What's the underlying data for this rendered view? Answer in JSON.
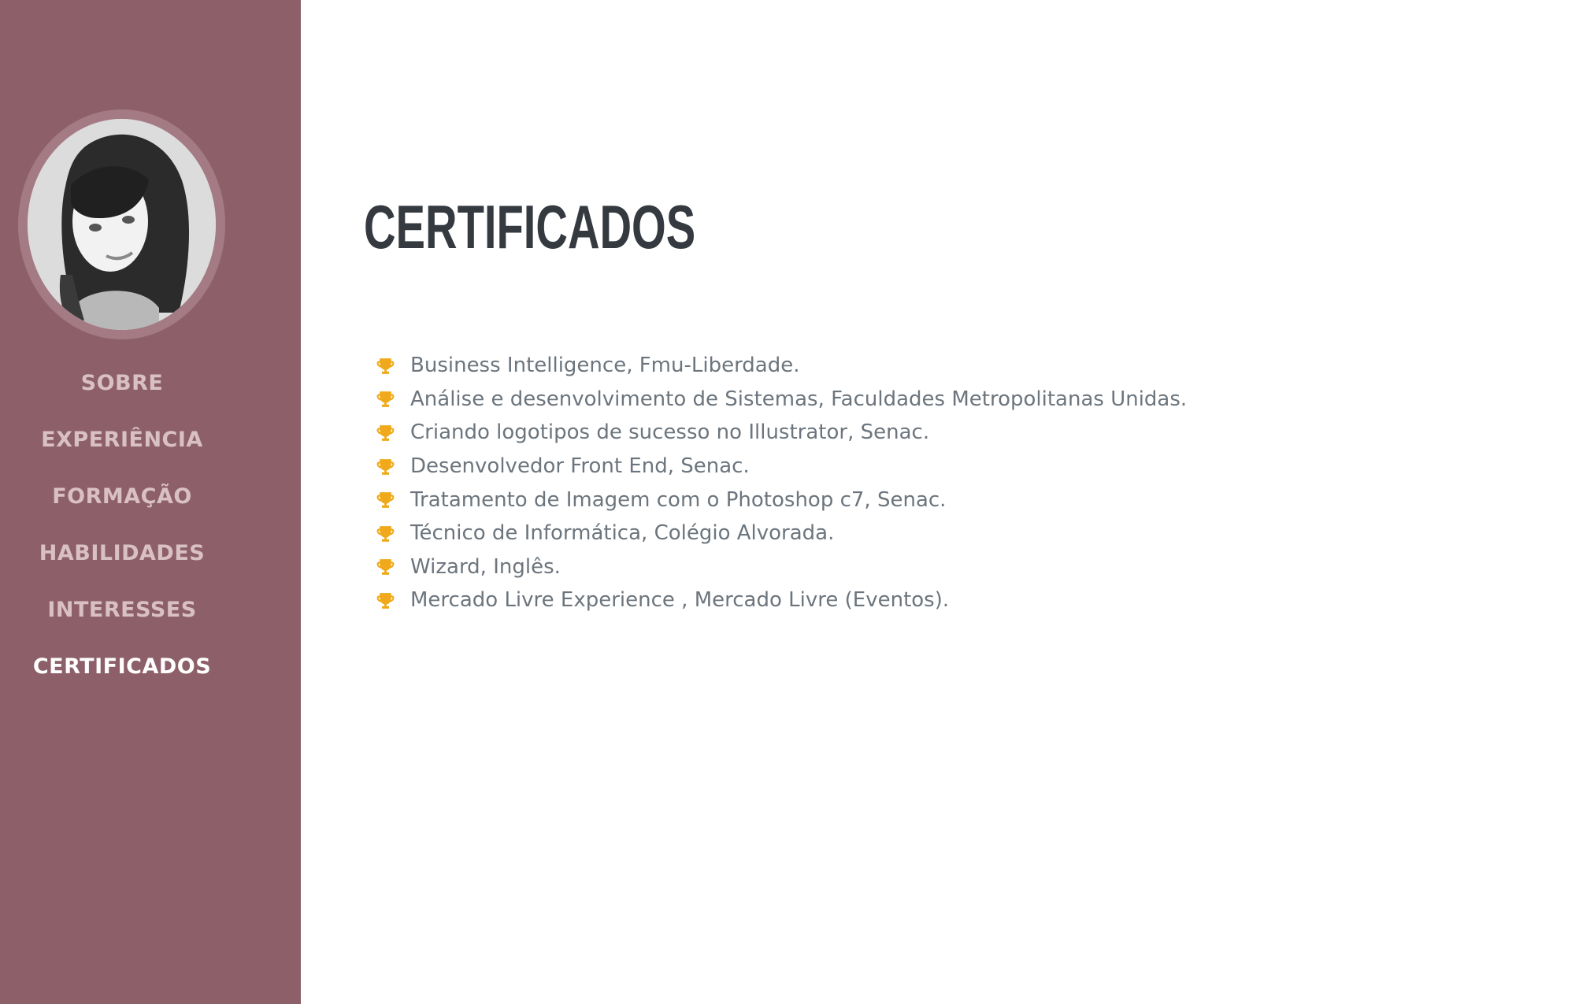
{
  "sidebar": {
    "avatar_icon": "profile-photo",
    "nav": [
      {
        "label": "SOBRE",
        "active": false
      },
      {
        "label": "EXPERIÊNCIA",
        "active": false
      },
      {
        "label": "FORMAÇÃO",
        "active": false
      },
      {
        "label": "HABILIDADES",
        "active": false
      },
      {
        "label": "INTERESSES",
        "active": false
      },
      {
        "label": "CERTIFICADOS",
        "active": true
      }
    ]
  },
  "main": {
    "title": "CERTIFICADOS",
    "item_icon": "trophy-icon",
    "certificates": [
      "Business Intelligence, Fmu-Liberdade.",
      "Análise e desenvolvimento de Sistemas, Faculdades Metropolitanas Unidas.",
      "Criando logotipos de sucesso no Illustrator, Senac.",
      "Desenvolvedor Front End, Senac.",
      "Tratamento de Imagem com o Photoshop c7, Senac.",
      "Técnico de Informática, Colégio Alvorada.",
      "Wizard, Inglês.",
      "Mercado Livre Experience , Mercado Livre (Eventos)."
    ]
  },
  "colors": {
    "sidebar_bg": "#8d5f69",
    "avatar_ring": "#a47b84",
    "nav_text": "#d9c0c5",
    "nav_active": "#ffffff",
    "title": "#343a40",
    "body_text": "#6c757d",
    "trophy": "#f0a91a"
  }
}
